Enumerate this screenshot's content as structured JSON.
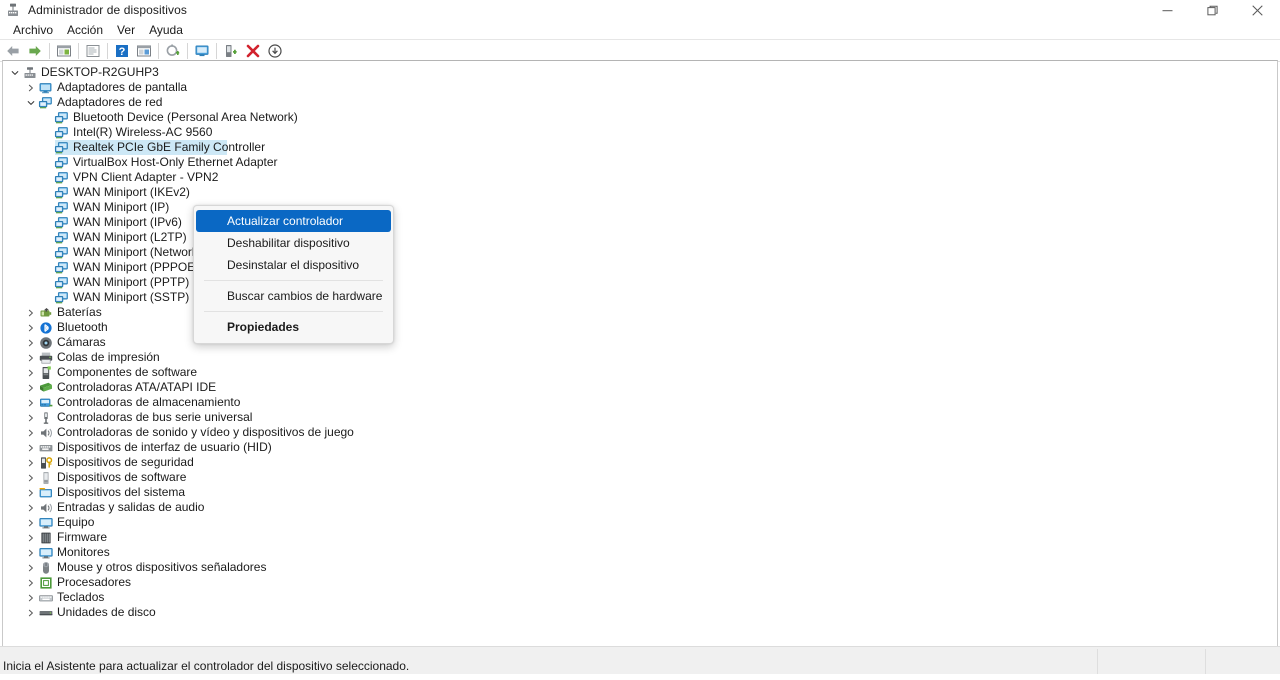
{
  "window": {
    "title": "Administrador de dispositivos",
    "icon": "device-manager-icon",
    "controls": {
      "minimize": "─",
      "restore": "❐",
      "close": "✕"
    }
  },
  "menubar": {
    "items": [
      {
        "label": "Archivo",
        "name": "menu-archivo"
      },
      {
        "label": "Acción",
        "name": "menu-accion"
      },
      {
        "label": "Ver",
        "name": "menu-ver"
      },
      {
        "label": "Ayuda",
        "name": "menu-ayuda"
      }
    ]
  },
  "toolbar": {
    "buttons": [
      {
        "name": "back-button",
        "icon": "arrow-left-icon",
        "label": "Atrás"
      },
      {
        "name": "forward-button",
        "icon": "arrow-right-icon",
        "label": "Adelante"
      },
      {
        "name": "show-hide-console-tree-button",
        "icon": "console-tree-icon",
        "label": "Mostrar/ocultar árbol de consola"
      },
      {
        "name": "properties-button",
        "icon": "properties-icon",
        "label": "Propiedades"
      },
      {
        "name": "help-button",
        "icon": "help-icon",
        "label": "Ayuda"
      },
      {
        "name": "view-button",
        "icon": "view-icon",
        "label": "Ver"
      },
      {
        "name": "update-driver-button",
        "icon": "update-driver-icon",
        "label": "Actualizar controlador"
      },
      {
        "name": "scan-hardware-changes-button",
        "icon": "scan-hardware-icon",
        "label": "Buscar cambios de hardware"
      },
      {
        "name": "enable-device-button",
        "icon": "enable-device-icon",
        "label": "Habilitar dispositivo"
      },
      {
        "name": "uninstall-device-button",
        "icon": "uninstall-device-icon",
        "label": "Desinstalar el dispositivo"
      },
      {
        "name": "disable-device-button",
        "icon": "disable-device-icon",
        "label": "Deshabilitar dispositivo"
      }
    ]
  },
  "tree": {
    "nodes": [
      {
        "label": "DESKTOP-R2GUHP3",
        "indent": 0,
        "state": "expanded",
        "icon": "computer-icon",
        "selected": false
      },
      {
        "label": "Adaptadores de pantalla",
        "indent": 1,
        "state": "collapsed",
        "icon": "display-adapter-icon",
        "selected": false
      },
      {
        "label": "Adaptadores de red",
        "indent": 1,
        "state": "expanded",
        "icon": "network-adapter-icon",
        "selected": false
      },
      {
        "label": "Bluetooth Device (Personal Area Network)",
        "indent": 2,
        "state": "leaf",
        "icon": "network-adapter-icon",
        "selected": false
      },
      {
        "label": "Intel(R) Wireless-AC 9560",
        "indent": 2,
        "state": "leaf",
        "icon": "network-adapter-icon",
        "selected": false
      },
      {
        "label": "Realtek PCIe GbE Family Controller",
        "indent": 2,
        "state": "leaf",
        "icon": "network-adapter-icon",
        "selected": true
      },
      {
        "label": "VirtualBox Host-Only Ethernet Adapter",
        "indent": 2,
        "state": "leaf",
        "icon": "network-adapter-icon",
        "selected": false
      },
      {
        "label": "VPN Client Adapter - VPN2",
        "indent": 2,
        "state": "leaf",
        "icon": "network-adapter-icon",
        "selected": false
      },
      {
        "label": "WAN Miniport (IKEv2)",
        "indent": 2,
        "state": "leaf",
        "icon": "network-adapter-icon",
        "selected": false
      },
      {
        "label": "WAN Miniport (IP)",
        "indent": 2,
        "state": "leaf",
        "icon": "network-adapter-icon",
        "selected": false
      },
      {
        "label": "WAN Miniport (IPv6)",
        "indent": 2,
        "state": "leaf",
        "icon": "network-adapter-icon",
        "selected": false
      },
      {
        "label": "WAN Miniport (L2TP)",
        "indent": 2,
        "state": "leaf",
        "icon": "network-adapter-icon",
        "selected": false
      },
      {
        "label": "WAN Miniport (Network Monitor)",
        "indent": 2,
        "state": "leaf",
        "icon": "network-adapter-icon",
        "selected": false
      },
      {
        "label": "WAN Miniport (PPPOE)",
        "indent": 2,
        "state": "leaf",
        "icon": "network-adapter-icon",
        "selected": false
      },
      {
        "label": "WAN Miniport (PPTP)",
        "indent": 2,
        "state": "leaf",
        "icon": "network-adapter-icon",
        "selected": false
      },
      {
        "label": "WAN Miniport (SSTP)",
        "indent": 2,
        "state": "leaf",
        "icon": "network-adapter-icon",
        "selected": false
      },
      {
        "label": "Baterías",
        "indent": 1,
        "state": "collapsed",
        "icon": "battery-icon",
        "selected": false
      },
      {
        "label": "Bluetooth",
        "indent": 1,
        "state": "collapsed",
        "icon": "bluetooth-icon",
        "selected": false
      },
      {
        "label": "Cámaras",
        "indent": 1,
        "state": "collapsed",
        "icon": "camera-icon",
        "selected": false
      },
      {
        "label": "Colas de impresión",
        "indent": 1,
        "state": "collapsed",
        "icon": "printer-icon",
        "selected": false
      },
      {
        "label": "Componentes de software",
        "indent": 1,
        "state": "collapsed",
        "icon": "software-component-icon",
        "selected": false
      },
      {
        "label": "Controladoras ATA/ATAPI IDE",
        "indent": 1,
        "state": "collapsed",
        "icon": "ide-controller-icon",
        "selected": false
      },
      {
        "label": "Controladoras de almacenamiento",
        "indent": 1,
        "state": "collapsed",
        "icon": "storage-controller-icon",
        "selected": false
      },
      {
        "label": "Controladoras de bus serie universal",
        "indent": 1,
        "state": "collapsed",
        "icon": "usb-controller-icon",
        "selected": false
      },
      {
        "label": "Controladoras de sonido y vídeo y dispositivos de juego",
        "indent": 1,
        "state": "collapsed",
        "icon": "sound-device-icon",
        "selected": false
      },
      {
        "label": "Dispositivos de interfaz de usuario (HID)",
        "indent": 1,
        "state": "collapsed",
        "icon": "hid-device-icon",
        "selected": false
      },
      {
        "label": "Dispositivos de seguridad",
        "indent": 1,
        "state": "collapsed",
        "icon": "security-device-icon",
        "selected": false
      },
      {
        "label": "Dispositivos de software",
        "indent": 1,
        "state": "collapsed",
        "icon": "software-device-icon",
        "selected": false
      },
      {
        "label": "Dispositivos del sistema",
        "indent": 1,
        "state": "collapsed",
        "icon": "system-device-icon",
        "selected": false
      },
      {
        "label": "Entradas y salidas de audio",
        "indent": 1,
        "state": "collapsed",
        "icon": "audio-io-icon",
        "selected": false
      },
      {
        "label": "Equipo",
        "indent": 1,
        "state": "collapsed",
        "icon": "monitor-icon",
        "selected": false
      },
      {
        "label": "Firmware",
        "indent": 1,
        "state": "collapsed",
        "icon": "firmware-icon",
        "selected": false
      },
      {
        "label": "Monitores",
        "indent": 1,
        "state": "collapsed",
        "icon": "monitor-icon",
        "selected": false
      },
      {
        "label": "Mouse y otros dispositivos señaladores",
        "indent": 1,
        "state": "collapsed",
        "icon": "mouse-icon",
        "selected": false
      },
      {
        "label": "Procesadores",
        "indent": 1,
        "state": "collapsed",
        "icon": "processor-icon",
        "selected": false
      },
      {
        "label": "Teclados",
        "indent": 1,
        "state": "collapsed",
        "icon": "keyboard-icon",
        "selected": false
      },
      {
        "label": "Unidades de disco",
        "indent": 1,
        "state": "collapsed",
        "icon": "disk-drive-icon",
        "selected": false
      }
    ]
  },
  "context_menu": {
    "items": [
      {
        "label": "Actualizar controlador",
        "name": "ctx-update-driver",
        "highlighted": true,
        "bold": false,
        "separator_after": false
      },
      {
        "label": "Deshabilitar dispositivo",
        "name": "ctx-disable-device",
        "highlighted": false,
        "bold": false,
        "separator_after": false
      },
      {
        "label": "Desinstalar el dispositivo",
        "name": "ctx-uninstall-device",
        "highlighted": false,
        "bold": false,
        "separator_after": true
      },
      {
        "label": "Buscar cambios de hardware",
        "name": "ctx-scan-hardware-changes",
        "highlighted": false,
        "bold": false,
        "separator_after": true
      },
      {
        "label": "Propiedades",
        "name": "ctx-properties",
        "highlighted": false,
        "bold": true,
        "separator_after": false
      }
    ]
  },
  "statusbar": {
    "message": "Inicia el Asistente para actualizar el controlador del dispositivo seleccionado.",
    "dividers": [
      1097,
      1205
    ]
  },
  "colors": {
    "menu_highlight": "#0a68c4",
    "row_selection": "#cde8f6",
    "window_bg": "#ffffff",
    "statusbar_bg": "#f0f0f0",
    "text": "#1b1b1b"
  }
}
